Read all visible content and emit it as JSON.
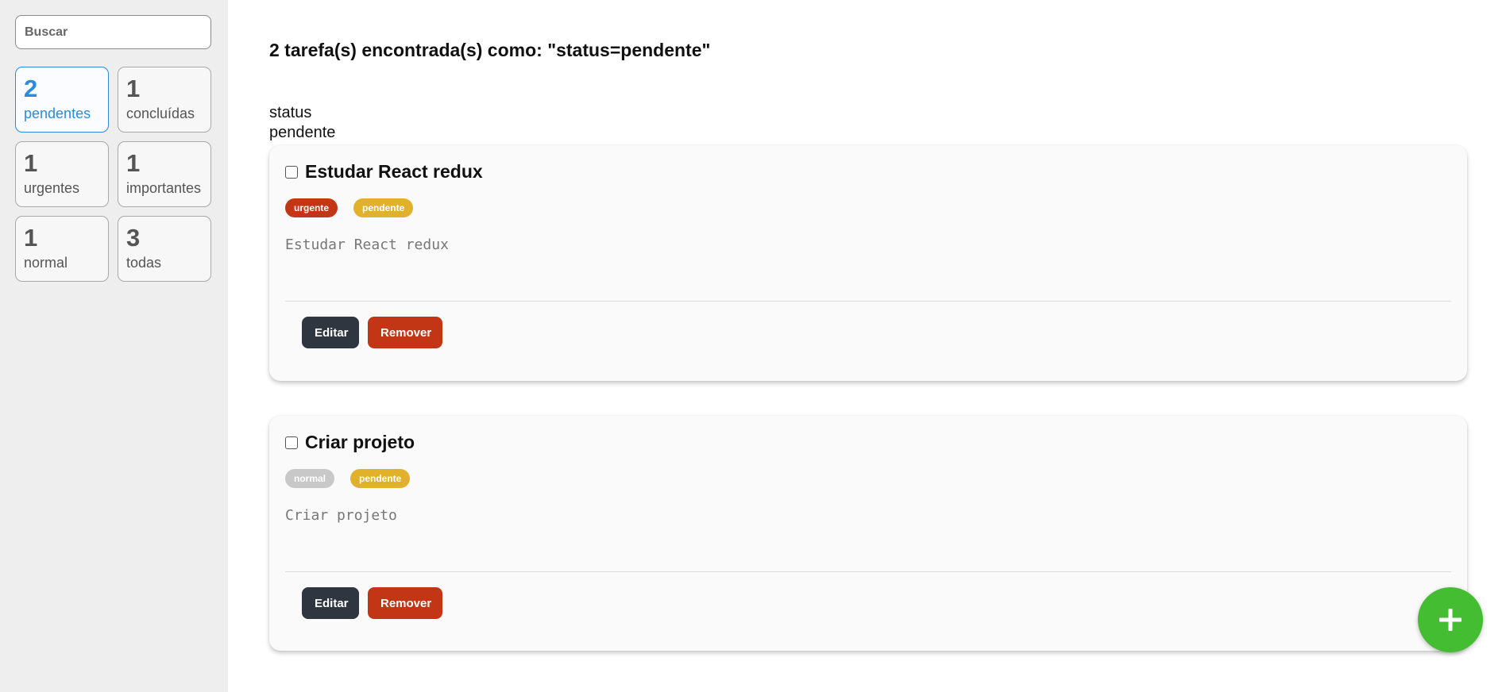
{
  "search": {
    "placeholder": "Buscar",
    "value": ""
  },
  "stats": [
    {
      "count": "2",
      "label": "pendentes",
      "active": true
    },
    {
      "count": "1",
      "label": "concluídas",
      "active": false
    },
    {
      "count": "1",
      "label": "urgentes",
      "active": false
    },
    {
      "count": "1",
      "label": "importantes",
      "active": false
    },
    {
      "count": "1",
      "label": "normal",
      "active": false
    },
    {
      "count": "3",
      "label": "todas",
      "active": false
    }
  ],
  "main": {
    "heading": "2 tarefa(s) encontrada(s) como: \"status=pendente\"",
    "filter_key": "status",
    "filter_value": "pendente"
  },
  "tasks": [
    {
      "title": "Estudar React redux",
      "tags": [
        {
          "label": "urgente",
          "color": "#c23616"
        },
        {
          "label": "pendente",
          "color": "#e1b12c"
        }
      ],
      "description": "Estudar React redux",
      "edit_label": "Editar",
      "remove_label": "Remover",
      "checked": false
    },
    {
      "title": "Criar projeto",
      "tags": [
        {
          "label": "normal",
          "color": "#c8c8c8"
        },
        {
          "label": "pendente",
          "color": "#e1b12c"
        }
      ],
      "description": "Criar projeto",
      "edit_label": "Editar",
      "remove_label": "Remover",
      "checked": false
    }
  ],
  "fab": {
    "icon": "plus-icon",
    "color": "#44bd32"
  }
}
